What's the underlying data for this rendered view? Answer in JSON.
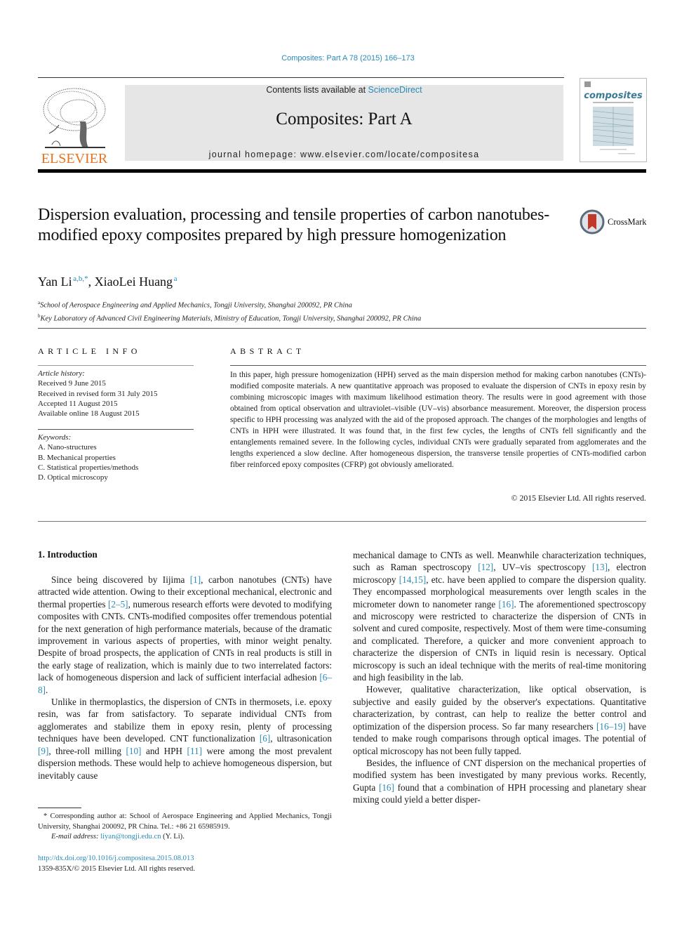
{
  "header": {
    "journal_ref": "Composites: Part A 78 (2015) 166–173",
    "contents_prefix": "Contents lists available at ",
    "contents_link": "ScienceDirect",
    "journal_name": "Composites: Part A",
    "homepage": "journal homepage: www.elsevier.com/locate/compositesa",
    "publisher_logo_text": "ELSEVIER",
    "cover_title": "composites",
    "cover_subtitle": "Part A: applied science and manufacturing"
  },
  "article": {
    "title": "Dispersion evaluation, processing and tensile properties of carbon nanotubes-modified epoxy composites prepared by high pressure homogenization",
    "crossmark_label": "CrossMark",
    "authors": [
      {
        "name": "Yan Li",
        "sup": "a,b,*"
      },
      {
        "name": "XiaoLei Huang",
        "sup": "a"
      }
    ],
    "author_sep": ", ",
    "affiliations": [
      {
        "mark": "a",
        "text": "School of Aerospace Engineering and Applied Mechanics, Tongji University, Shanghai 200092, PR China"
      },
      {
        "mark": "b",
        "text": "Key Laboratory of Advanced Civil Engineering Materials, Ministry of Education, Tongji University, Shanghai 200092, PR China"
      }
    ]
  },
  "article_info": {
    "heading": "ARTICLE INFO",
    "history_label": "Article history:",
    "history": [
      "Received 9 June 2015",
      "Received in revised form 31 July 2015",
      "Accepted 11 August 2015",
      "Available online 18 August 2015"
    ],
    "keywords_label": "Keywords:",
    "keywords": [
      "A. Nano-structures",
      "B. Mechanical properties",
      "C. Statistical properties/methods",
      "D. Optical microscopy"
    ]
  },
  "abstract": {
    "heading": "ABSTRACT",
    "text": "In this paper, high pressure homogenization (HPH) served as the main dispersion method for making carbon nanotubes (CNTs)-modified composite materials. A new quantitative approach was proposed to evaluate the dispersion of CNTs in epoxy resin by combining microscopic images with maximum likelihood estimation theory. The results were in good agreement with those obtained from optical observation and ultraviolet–visible (UV–vis) absorbance measurement. Moreover, the dispersion process specific to HPH processing was analyzed with the aid of the proposed approach. The changes of the morphologies and lengths of CNTs in HPH were illustrated. It was found that, in the first few cycles, the lengths of CNTs fell significantly and the entanglements remained severe. In the following cycles, individual CNTs were gradually separated from agglomerates and the lengths experienced a slow decline. After homogeneous dispersion, the transverse tensile properties of CNTs-modified carbon fiber reinforced epoxy composites (CFRP) got obviously ameliorated.",
    "copyright": "© 2015 Elsevier Ltd. All rights reserved."
  },
  "body": {
    "section_heading": "1. Introduction",
    "left_paragraphs": [
      [
        {
          "t": "Since being discovered by Iijima "
        },
        {
          "c": "[1]"
        },
        {
          "t": ", carbon nanotubes (CNTs) have attracted wide attention. Owing to their exceptional mechanical, electronic and thermal properties "
        },
        {
          "c": "[2–5]"
        },
        {
          "t": ", numerous research efforts were devoted to modifying composites with CNTs. CNTs-modified composites offer tremendous potential for the next generation of high performance materials, because of the dramatic improvement in various aspects of properties, with minor weight penalty. Despite of broad prospects, the application of CNTs in real products is still in the early stage of realization, which is mainly due to two interrelated factors: lack of homogeneous dispersion and lack of sufficient interfacial adhesion "
        },
        {
          "c": "[6–8]"
        },
        {
          "t": "."
        }
      ],
      [
        {
          "t": "Unlike in thermoplastics, the dispersion of CNTs in thermosets, i.e. epoxy resin, was far from satisfactory. To separate individual CNTs from agglomerates and stabilize them in epoxy resin, plenty of processing techniques have been developed. CNT functionalization "
        },
        {
          "c": "[6]"
        },
        {
          "t": ", ultrasonication "
        },
        {
          "c": "[9]"
        },
        {
          "t": ", three-roll milling "
        },
        {
          "c": "[10]"
        },
        {
          "t": " and HPH "
        },
        {
          "c": "[11]"
        },
        {
          "t": " were among the most prevalent dispersion methods. These would help to achieve homogeneous dispersion, but inevitably cause"
        }
      ]
    ],
    "right_paragraphs": [
      [
        {
          "t": "mechanical damage to CNTs as well. Meanwhile characterization techniques, such as Raman spectroscopy "
        },
        {
          "c": "[12]"
        },
        {
          "t": ", UV–vis spectroscopy "
        },
        {
          "c": "[13]"
        },
        {
          "t": ", electron microscopy "
        },
        {
          "c": "[14,15]"
        },
        {
          "t": ", etc. have been applied to compare the dispersion quality. They encompassed morphological measurements over length scales in the micrometer down to nanometer range "
        },
        {
          "c": "[16]"
        },
        {
          "t": ". The aforementioned spectroscopy and microscopy were restricted to characterize the dispersion of CNTs in solvent and cured composite, respectively. Most of them were time-consuming and complicated. Therefore, a quicker and more convenient approach to characterize the dispersion of CNTs in liquid resin is necessary. Optical microscopy is such an ideal technique with the merits of real-time monitoring and high feasibility in the lab."
        }
      ],
      [
        {
          "t": "However, qualitative characterization, like optical observation, is subjective and easily guided by the observer's expectations. Quantitative characterization, by contrast, can help to realize the better control and optimization of the dispersion process. So far many researchers "
        },
        {
          "c": "[16–19]"
        },
        {
          "t": " have tended to make rough comparisons through optical images. The potential of optical microscopy has not been fully tapped."
        }
      ],
      [
        {
          "t": "Besides, the influence of CNT dispersion on the mechanical properties of modified system has been investigated by many previous works. Recently, Gupta "
        },
        {
          "c": "[16]"
        },
        {
          "t": " found that a combination of HPH processing and planetary shear mixing could yield a better disper-"
        }
      ]
    ]
  },
  "footnote": {
    "corresponding": "* Corresponding author at: School of Aerospace Engineering and Applied Mechanics, Tongji University, Shanghai 200092, PR China. Tel.: +86 21 65985919.",
    "email_label": "E-mail address: ",
    "email": "liyan@tongji.edu.cn",
    "email_suffix": " (Y. Li).",
    "doi": "http://dx.doi.org/10.1016/j.compositesa.2015.08.013",
    "issn": "1359-835X/© 2015 Elsevier Ltd. All rights reserved."
  },
  "colors": {
    "link": "#2a8ab8",
    "elsevier_orange": "#e8731f",
    "masthead_bg": "#e6e6e6"
  }
}
